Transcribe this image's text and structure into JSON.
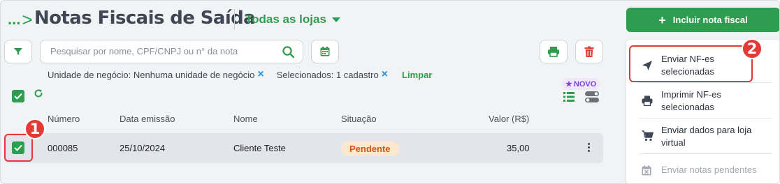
{
  "header": {
    "breadcrumb_dots": "...",
    "breadcrumb_sep": ">",
    "title": "Notas Fiscais de Saída",
    "store_selector": "Todas as lojas",
    "add_button": "Incluir nota fiscal"
  },
  "search": {
    "placeholder": "Pesquisar por nome, CPF/CNPJ ou n° da nota"
  },
  "filters": {
    "chips": [
      "Unidade de negócio: Nenhuma unidade de negócio",
      "Selecionados: 1 cadastro"
    ],
    "clear_label": "Limpar"
  },
  "badge_new": "NOVO",
  "table": {
    "columns": [
      "Número",
      "Data emissão",
      "Nome",
      "Situação",
      "Valor (R$)"
    ],
    "rows": [
      {
        "numero": "000085",
        "data": "25/10/2024",
        "nome": "Cliente Teste",
        "situacao": "Pendente",
        "valor": "35,00"
      }
    ]
  },
  "menu": {
    "items": [
      {
        "label": "Enviar NF-es selecionadas",
        "icon": "send-icon",
        "enabled": true
      },
      {
        "label": "Imprimir NF-es selecionadas",
        "icon": "printer-icon",
        "enabled": true
      },
      {
        "label": "Enviar dados para loja virtual",
        "icon": "cart-icon",
        "enabled": true
      },
      {
        "label": "Enviar notas pendentes",
        "icon": "calendar-x-icon",
        "enabled": false
      }
    ]
  },
  "annotations": {
    "step1": "1",
    "step2": "2"
  },
  "colors": {
    "primary": "#2f9d4f",
    "highlight": "#e53935",
    "status_pending_bg": "#fde7cf",
    "status_pending_text": "#c55b14",
    "new_badge": "#7b45d6"
  }
}
